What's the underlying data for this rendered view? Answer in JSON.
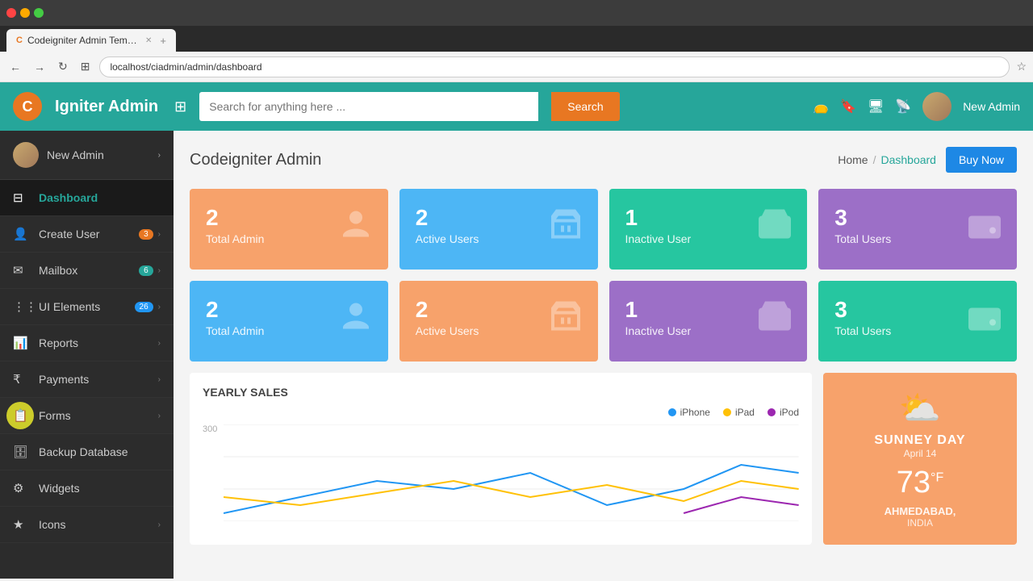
{
  "browser": {
    "tab_title": "Codeigniter Admin Templ...",
    "address": "localhost/ciadmin/admin/dashboard"
  },
  "header": {
    "logo_letter": "C",
    "app_title": "Igniter Admin",
    "search_placeholder": "Search for anything here ...",
    "search_btn_label": "Search",
    "username": "New Admin",
    "icons": [
      "wallet-icon",
      "bookmark-icon",
      "monitor-icon",
      "feed-icon"
    ]
  },
  "sidebar": {
    "user_name": "New Admin",
    "items": [
      {
        "id": "dashboard",
        "label": "Dashboard",
        "icon": "⊟",
        "badge": null,
        "active": true
      },
      {
        "id": "create-user",
        "label": "Create User",
        "icon": "👤",
        "badge": "3",
        "badge_color": "orange",
        "has_arrow": true
      },
      {
        "id": "mailbox",
        "label": "Mailbox",
        "icon": "✉",
        "badge": "6",
        "badge_color": "green",
        "has_arrow": true
      },
      {
        "id": "ui-elements",
        "label": "UI Elements",
        "icon": "⋮⋮",
        "badge": "26",
        "badge_color": "blue",
        "has_arrow": true
      },
      {
        "id": "reports",
        "label": "Reports",
        "icon": "📊",
        "badge": null,
        "has_arrow": true
      },
      {
        "id": "payments",
        "label": "Payments",
        "icon": "₹",
        "badge": null,
        "has_arrow": true
      },
      {
        "id": "forms",
        "label": "Forms",
        "icon": "📋",
        "badge": null,
        "has_arrow": true,
        "hover": true
      },
      {
        "id": "backup-database",
        "label": "Backup Database",
        "icon": "🗄",
        "badge": null
      },
      {
        "id": "widgets",
        "label": "Widgets",
        "icon": "⚙",
        "badge": null
      },
      {
        "id": "icons",
        "label": "Icons",
        "icon": "★",
        "badge": null,
        "has_arrow": true
      }
    ]
  },
  "main": {
    "page_title": "Codeigniter Admin",
    "breadcrumb_home": "Home",
    "breadcrumb_sep": "/",
    "breadcrumb_current": "Dashboard",
    "buy_now_label": "Buy Now",
    "stat_cards_row1": [
      {
        "number": "2",
        "label": "Total Admin",
        "color": "orange",
        "icon": "person"
      },
      {
        "number": "2",
        "label": "Active Users",
        "color": "blue",
        "icon": "cart"
      },
      {
        "number": "1",
        "label": "Inactive User",
        "color": "teal",
        "icon": "wallet"
      },
      {
        "number": "3",
        "label": "Total Users",
        "color": "purple",
        "icon": "wallet2"
      }
    ],
    "stat_cards_row2": [
      {
        "number": "2",
        "label": "Total Admin",
        "color": "blue",
        "icon": "person"
      },
      {
        "number": "2",
        "label": "Active Users",
        "color": "orange",
        "icon": "cart"
      },
      {
        "number": "1",
        "label": "Inactive User",
        "color": "purple",
        "icon": "wallet"
      },
      {
        "number": "3",
        "label": "Total Users",
        "color": "teal",
        "icon": "wallet2"
      }
    ],
    "chart": {
      "title": "YEARLY SALES",
      "legend": [
        {
          "label": "iPhone",
          "color": "#2196f3"
        },
        {
          "label": "iPad",
          "color": "#ffc107"
        },
        {
          "label": "iPod",
          "color": "#9c27b0"
        }
      ],
      "y_values": [
        "300",
        "",
        ""
      ]
    },
    "weather": {
      "icon": "☁",
      "label": "SUNNEY DAY",
      "date": "April 14",
      "temp": "73",
      "unit": "°F",
      "city": "AHMEDABAD,",
      "country": "INDIA"
    }
  }
}
